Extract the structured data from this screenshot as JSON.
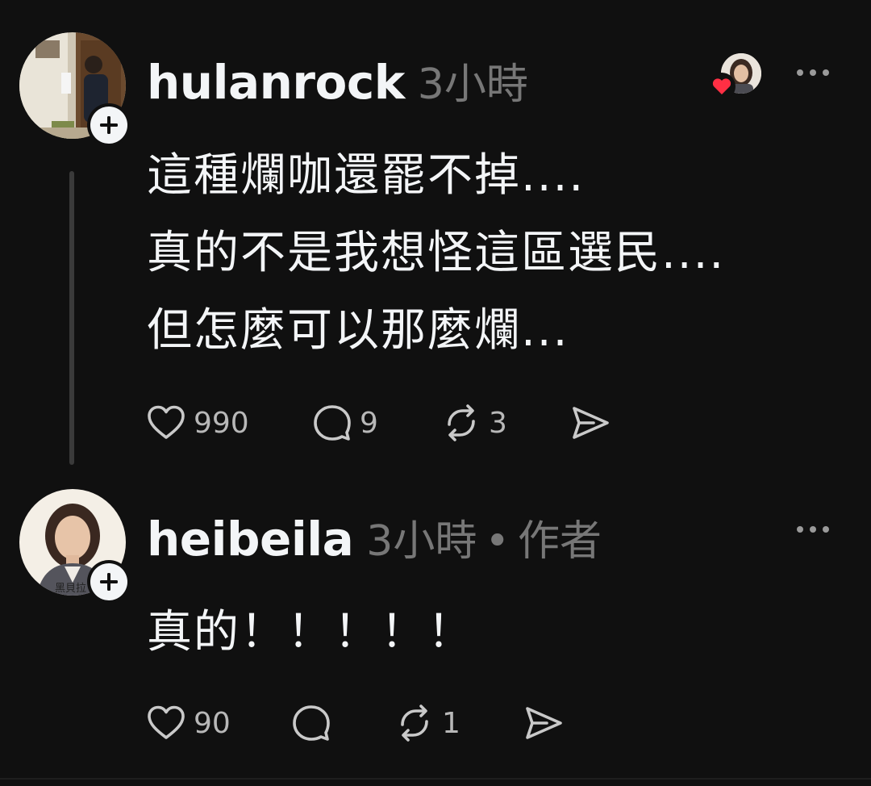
{
  "posts": [
    {
      "username": "hulanrock",
      "time": "3小時",
      "lines": [
        "這種爛咖還罷不掉....",
        "真的不是我想怪這區選民....",
        "但怎麼可以那麼爛..."
      ],
      "likes": "990",
      "comments": "9",
      "reposts": "3"
    },
    {
      "username": "heibeila",
      "time": "3小時",
      "separator": "•",
      "role": "作者",
      "avatar_caption": "黑貝拉",
      "lines": [
        "真的！！！！！"
      ],
      "likes": "90",
      "comments": "",
      "reposts": "1"
    }
  ],
  "colors": {
    "background": "#101010",
    "text": "#f3f5f7",
    "muted": "#777777",
    "heart": "#ff2f44"
  },
  "icons": [
    "plus-icon",
    "heart-icon",
    "comment-icon",
    "repost-icon",
    "share-icon",
    "more-icon"
  ]
}
